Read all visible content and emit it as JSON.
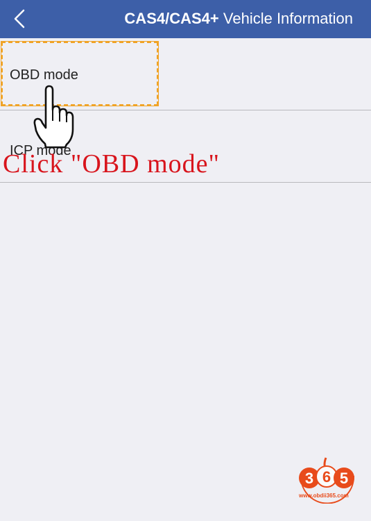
{
  "header": {
    "title_model": "CAS4/CAS4+",
    "title_page": "Vehicle Information"
  },
  "list": {
    "items": [
      {
        "label": "OBD mode"
      },
      {
        "label": "ICP mode"
      }
    ]
  },
  "annotation": {
    "text": "Click \"OBD  mode\""
  },
  "watermark": {
    "digits": "365",
    "url": "www.obdii365.com"
  },
  "colors": {
    "header_bg": "#3d5fa8",
    "background": "#efeff4",
    "highlight": "#f0a326",
    "annotation": "#d8141c",
    "logo": "#e84b1b"
  },
  "icons": {
    "back": "chevron-left-icon",
    "pointer": "hand-pointer-icon"
  }
}
